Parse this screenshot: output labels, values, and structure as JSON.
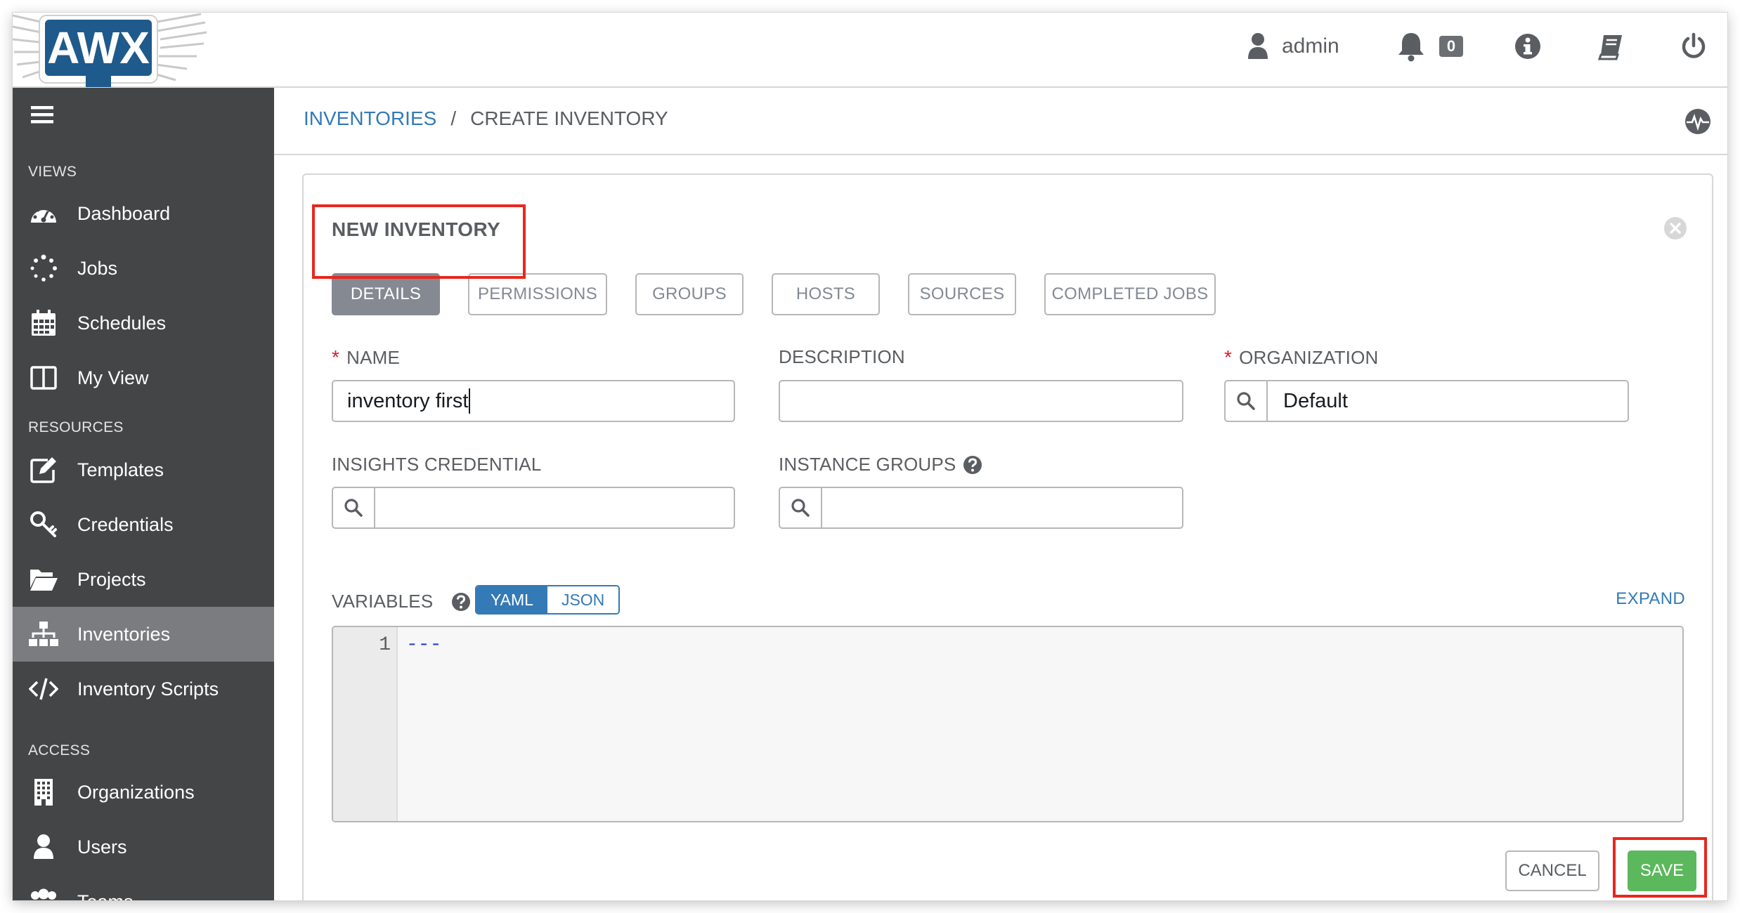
{
  "header": {
    "user_name": "admin",
    "notification_count": "0",
    "icons": [
      "user-icon",
      "bell-icon",
      "info-icon",
      "docs-book-icon",
      "power-icon"
    ]
  },
  "logo": {
    "text": "AWX"
  },
  "sidebar": {
    "sections": {
      "views": "VIEWS",
      "resources": "RESOURCES",
      "access": "ACCESS"
    },
    "views_items": [
      {
        "label": "Dashboard",
        "icon": "dashboard-icon"
      },
      {
        "label": "Jobs",
        "icon": "jobs-spinner-icon"
      },
      {
        "label": "Schedules",
        "icon": "calendar-icon"
      },
      {
        "label": "My View",
        "icon": "columns-icon"
      }
    ],
    "resources_items": [
      {
        "label": "Templates",
        "icon": "edit-icon"
      },
      {
        "label": "Credentials",
        "icon": "key-icon"
      },
      {
        "label": "Projects",
        "icon": "folder-open-icon"
      },
      {
        "label": "Inventories",
        "icon": "sitemap-icon",
        "active": true
      },
      {
        "label": "Inventory Scripts",
        "icon": "code-icon"
      }
    ],
    "access_items": [
      {
        "label": "Organizations",
        "icon": "building-icon"
      },
      {
        "label": "Users",
        "icon": "user-icon"
      },
      {
        "label": "Teams",
        "icon": "users-icon"
      }
    ]
  },
  "breadcrumb": {
    "link": "INVENTORIES",
    "separator": "/",
    "current": "CREATE INVENTORY"
  },
  "panel": {
    "title": "NEW INVENTORY",
    "tabs": [
      {
        "label": "DETAILS",
        "active": true
      },
      {
        "label": "PERMISSIONS"
      },
      {
        "label": "GROUPS"
      },
      {
        "label": "HOSTS"
      },
      {
        "label": "SOURCES"
      },
      {
        "label": "COMPLETED JOBS"
      }
    ],
    "fields": {
      "name": {
        "label": "NAME",
        "required": "*",
        "value": "inventory first"
      },
      "description": {
        "label": "DESCRIPTION",
        "value": ""
      },
      "organization": {
        "label": "ORGANIZATION",
        "required": "*",
        "value": "Default"
      },
      "insights_credential": {
        "label": "INSIGHTS CREDENTIAL",
        "value": ""
      },
      "instance_groups": {
        "label": "INSTANCE GROUPS",
        "value": ""
      }
    },
    "variables": {
      "label": "VARIABLES",
      "modes": [
        "YAML",
        "JSON"
      ],
      "active_mode": "YAML",
      "expand": "EXPAND",
      "lines": [
        {
          "num": "1",
          "text": "---"
        }
      ]
    },
    "buttons": {
      "cancel": "CANCEL",
      "save": "SAVE"
    }
  },
  "colors": {
    "sidebar_bg": "#434547",
    "sidebar_active": "#7a7c7f",
    "link_blue": "#337ab7",
    "save_green": "#5cb85c",
    "required_red": "#d81f26",
    "highlight_red": "#e8271e",
    "logo_blue": "#1f5a8c"
  }
}
